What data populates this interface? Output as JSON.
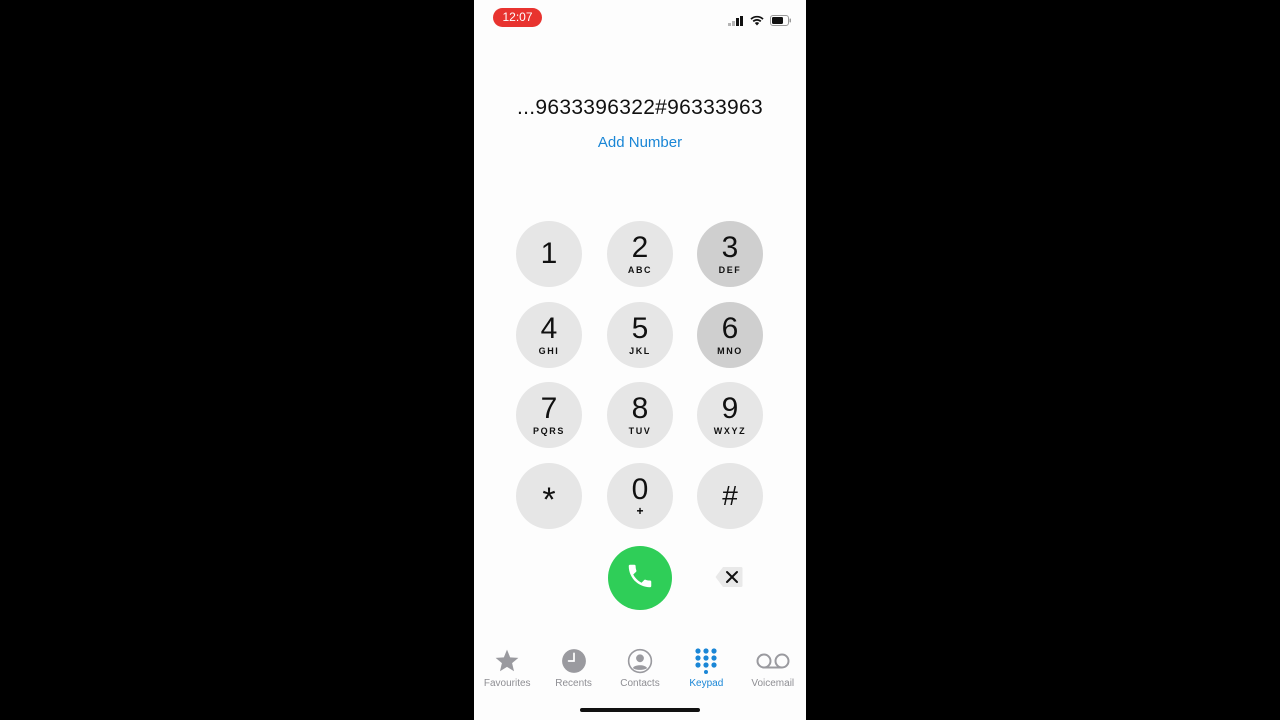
{
  "status_bar": {
    "time": "12:07"
  },
  "dialer": {
    "number": "...9633396322#96333963",
    "add_number_label": "Add Number"
  },
  "keypad": {
    "keys": [
      {
        "digit": "1",
        "letters": ""
      },
      {
        "digit": "2",
        "letters": "ABC"
      },
      {
        "digit": "3",
        "letters": "DEF"
      },
      {
        "digit": "4",
        "letters": "GHI"
      },
      {
        "digit": "5",
        "letters": "JKL"
      },
      {
        "digit": "6",
        "letters": "MNO"
      },
      {
        "digit": "7",
        "letters": "PQRS"
      },
      {
        "digit": "8",
        "letters": "TUV"
      },
      {
        "digit": "9",
        "letters": "WXYZ"
      },
      {
        "digit": "*",
        "letters": ""
      },
      {
        "digit": "0",
        "letters": "+"
      },
      {
        "digit": "#",
        "letters": ""
      }
    ]
  },
  "tabs": [
    {
      "label": "Favourites",
      "icon": "star-icon"
    },
    {
      "label": "Recents",
      "icon": "clock-icon"
    },
    {
      "label": "Contacts",
      "icon": "person-icon"
    },
    {
      "label": "Keypad",
      "icon": "keypad-icon",
      "active": true
    },
    {
      "label": "Voicemail",
      "icon": "voicemail-icon"
    }
  ],
  "colors": {
    "accent": "#1a86d6",
    "call_green": "#2fce58",
    "recording_red": "#e8332f"
  }
}
